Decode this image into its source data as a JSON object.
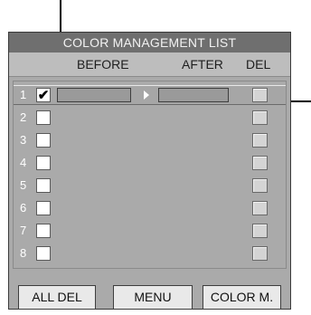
{
  "panel": {
    "title": "COLOR MANAGEMENT LIST",
    "columns": {
      "before": "BEFORE",
      "after": "AFTER",
      "del": "DEL"
    }
  },
  "rows": [
    {
      "num": "1",
      "check": "✔"
    },
    {
      "num": "2"
    },
    {
      "num": "3"
    },
    {
      "num": "4"
    },
    {
      "num": "5"
    },
    {
      "num": "6"
    },
    {
      "num": "7"
    },
    {
      "num": "8"
    }
  ],
  "buttons": {
    "all_del": "ALL DEL",
    "menu": "MENU",
    "color_m": "COLOR M."
  }
}
